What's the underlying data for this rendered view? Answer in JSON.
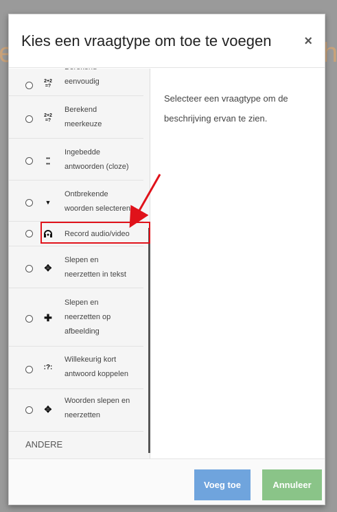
{
  "background": {
    "left_glyph": "e",
    "right_glyph": "h"
  },
  "dialog": {
    "title": "Kies een vraagtype om toe te voegen",
    "close_glyph": "×",
    "description": "Selecteer een vraagtype om de beschrijving ervan te zien."
  },
  "options": [
    {
      "icon": "calculated-simple-icon",
      "glyph": "2+2\n=?",
      "line1": "Berekend",
      "line2": "eenvoudig"
    },
    {
      "icon": "calculated-multichoice-icon",
      "glyph": "2+2\n=?",
      "line1": "Berekend",
      "line2": "meerkeuze"
    },
    {
      "icon": "embedded-answers-icon",
      "glyph": "▪▪\n▪▪",
      "line1": "Ingebedde",
      "line2": "antwoorden (cloze)"
    },
    {
      "icon": "dropdown-icon",
      "glyph": "▼",
      "line1": "Ontbrekende",
      "line2": "woorden selecteren"
    },
    {
      "icon": "headset-icon",
      "glyph": "🎧",
      "line1": "Record audio/video"
    },
    {
      "icon": "move-icon",
      "glyph": "✥",
      "line1": "Slepen en",
      "line2": "neerzetten in tekst"
    },
    {
      "icon": "cross-move-icon",
      "glyph": "✚",
      "line1": "Slepen en",
      "line2": "neerzetten op",
      "line3": "afbeelding"
    },
    {
      "icon": "random-match-icon",
      "glyph": ":?:",
      "line1": "Willekeurig kort",
      "line2": "antwoord koppelen"
    },
    {
      "icon": "drag-words-icon",
      "glyph": "✥",
      "line1": "Woorden slepen en",
      "line2": "neerzetten"
    }
  ],
  "section_other": "ANDERE",
  "buttons": {
    "add": "Voeg toe",
    "cancel": "Annuleer"
  },
  "colors": {
    "add_button": "#6fa4dd",
    "cancel_button": "#8ac488",
    "highlight": "#e0121a"
  }
}
